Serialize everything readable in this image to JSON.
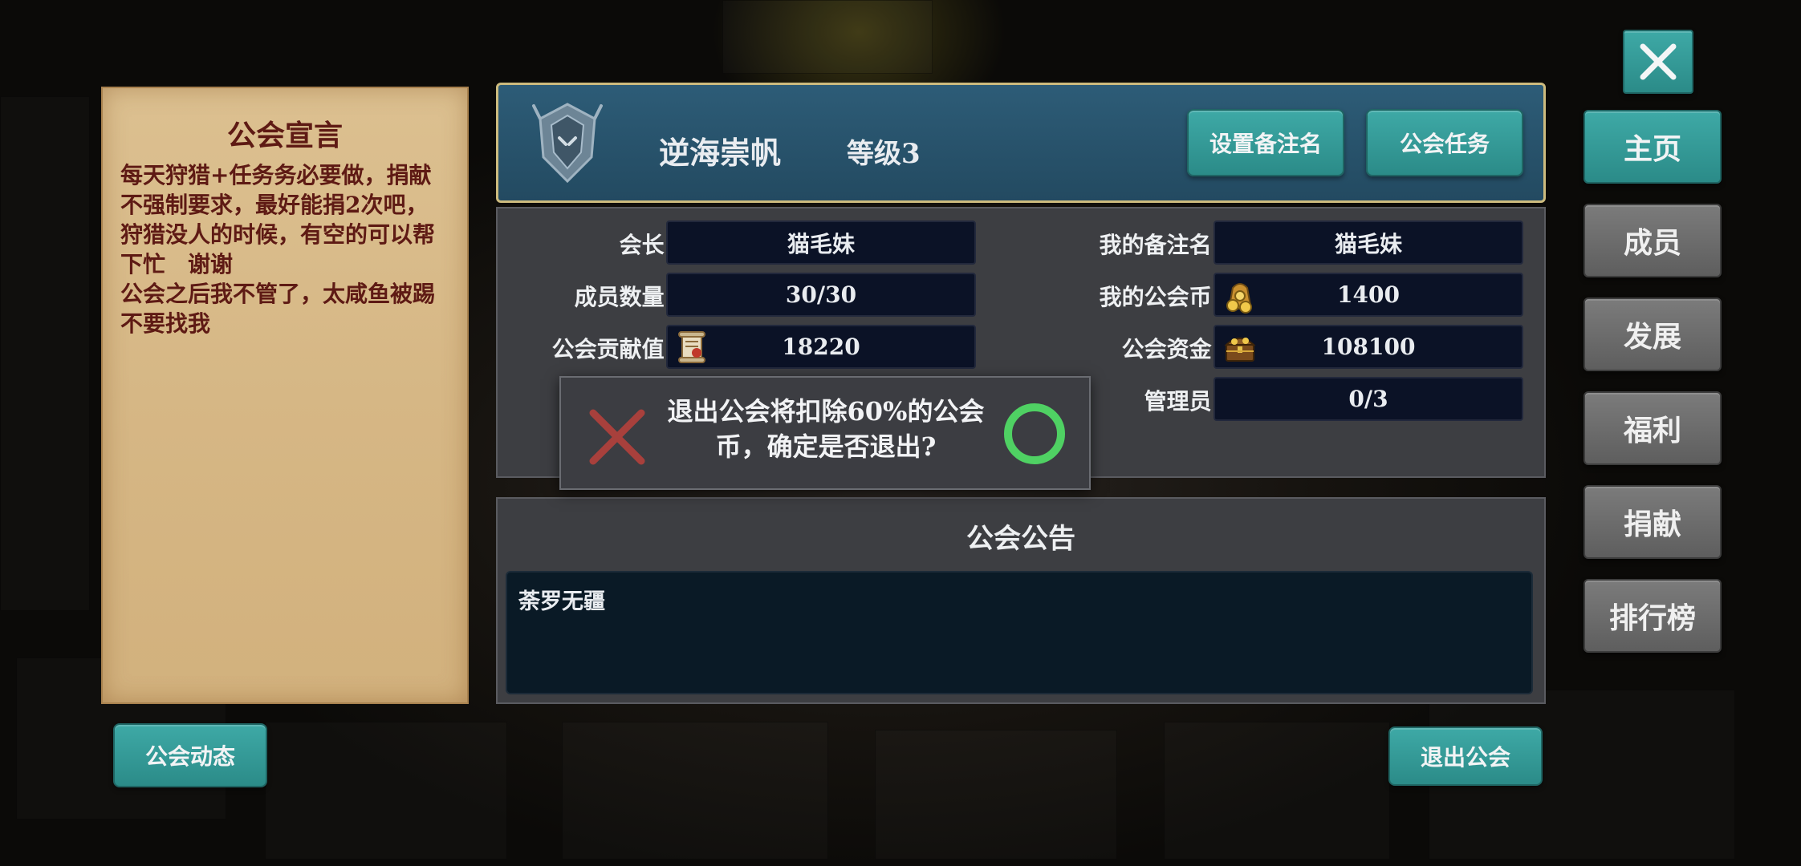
{
  "manifesto": {
    "title": "公会宣言",
    "body": "每天狩猎+任务务必要做，捐献\n不强制要求，最好能捐2次吧，\n狩猎没人的时候，有空的可以帮\n下忙　谢谢\n公会之后我不管了，太咸鱼被踢\n不要找我"
  },
  "header": {
    "guild_name": "逆海崇帆",
    "level": "等级3",
    "set_note_button": "设置备注名",
    "guild_task_button": "公会任务"
  },
  "info": {
    "leader_label": "会长:",
    "leader_value": "猫毛妹",
    "members_label": "成员数量:",
    "members_value": "30/30",
    "contribution_label": "公会贡献值:",
    "contribution_value": "18220",
    "my_note_label": "我的备注名:",
    "my_note_value": "猫毛妹",
    "my_coins_label": "我的公会币:",
    "my_coins_value": "1400",
    "funds_label": "公会资金:",
    "funds_value": "108100",
    "admins_label": "管理员:",
    "admins_value": "0/3"
  },
  "notice": {
    "title": "公会公告",
    "text": "荼罗无疆"
  },
  "dialog": {
    "message": "退出公会将扣除60%的公会币，确定是否退出?",
    "cancel_icon": "red-x-icon",
    "confirm_icon": "green-circle-icon"
  },
  "sidebar": {
    "items": [
      {
        "label": "主页"
      },
      {
        "label": "成员"
      },
      {
        "label": "发展"
      },
      {
        "label": "福利"
      },
      {
        "label": "捐献"
      },
      {
        "label": "排行榜"
      }
    ]
  },
  "bottom": {
    "guild_news_button": "公会动态",
    "leave_guild_button": "退出公会"
  },
  "colors": {
    "accent_teal": "#2b8b88",
    "header_blue": "#234a61",
    "parchment": "#d6b785",
    "manifesto_text": "#5e1a14",
    "confirm_green": "#4fd163",
    "cancel_red": "#a8403c"
  }
}
